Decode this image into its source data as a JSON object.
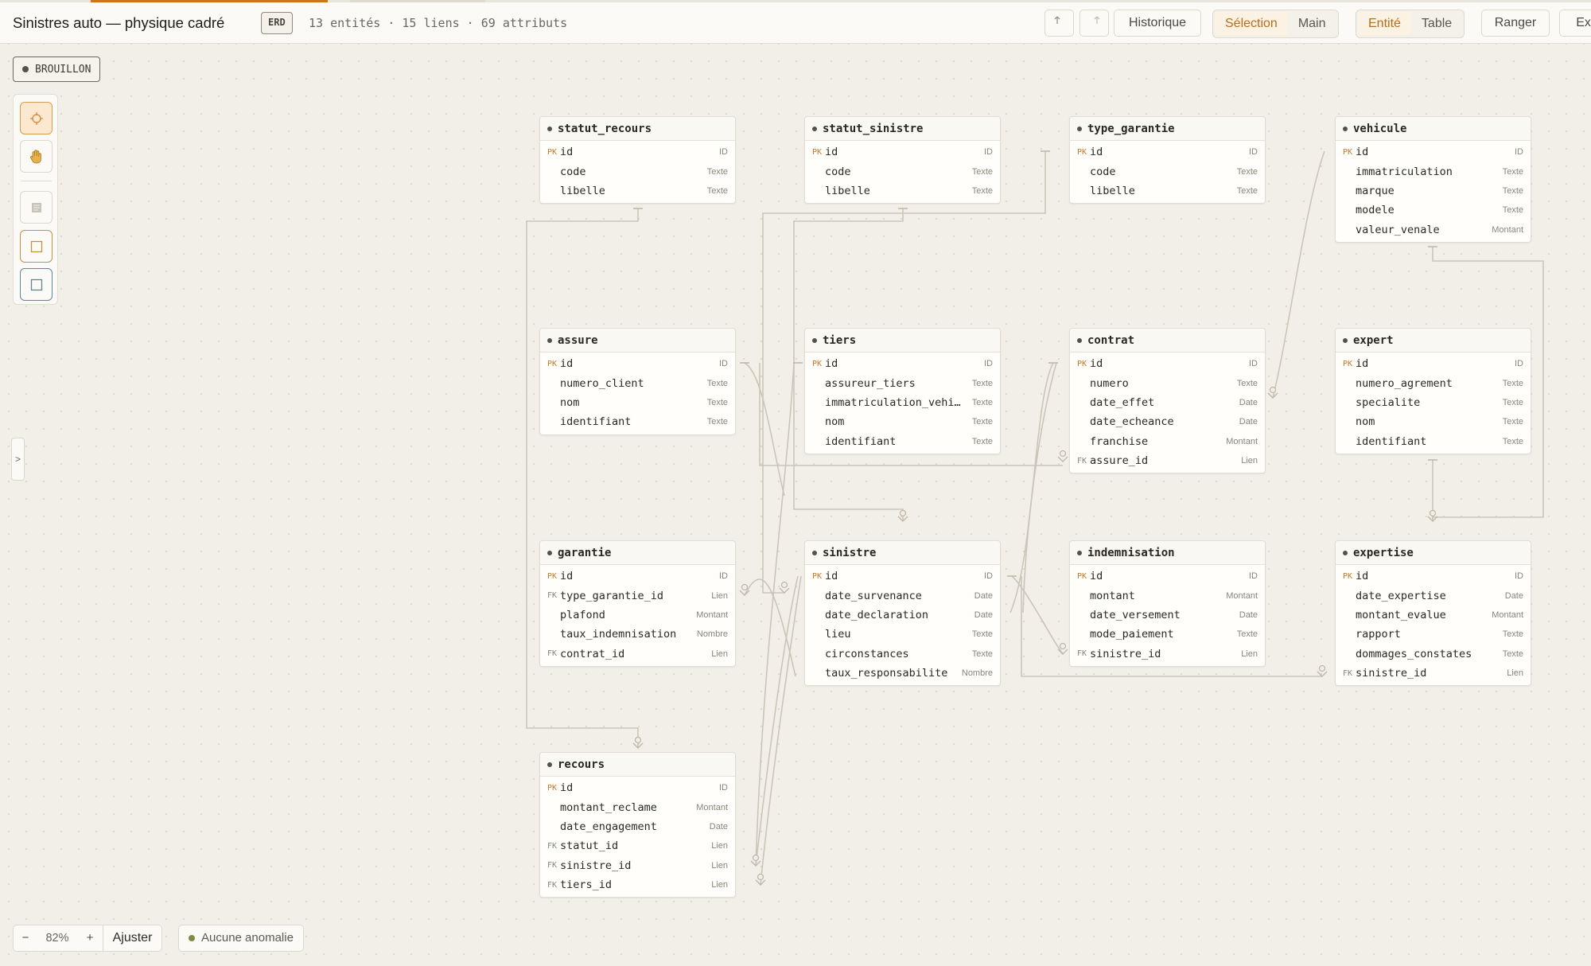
{
  "header": {
    "title": "Sinistres auto — physique cadré",
    "badge": "ERD",
    "stats": "13 entités · 15 liens · 69 attributs",
    "undo_icon": "undo-icon",
    "redo_icon": "redo-icon",
    "history_label": "Historique",
    "mode_selection": "Sélection",
    "mode_hand": "Main",
    "view_entity": "Entité",
    "view_table": "Table",
    "arrange_label": "Ranger",
    "export_label": "Exp"
  },
  "status_badge": "BROUILLON",
  "sidebar_toggle": ">",
  "zoom": {
    "minus": "−",
    "value": "82%",
    "plus": "+",
    "fit_label": "Ajuster"
  },
  "anomalies": "Aucune anomalie",
  "tools": [
    "crosshair-icon",
    "hand-icon",
    "note-icon",
    "entity-box-icon",
    "table-box-icon"
  ],
  "entities": [
    {
      "name": "statut_recours",
      "fields": [
        {
          "key": "PK",
          "name": "id",
          "type": "ID"
        },
        {
          "key": "",
          "name": "code",
          "type": "Texte"
        },
        {
          "key": "",
          "name": "libelle",
          "type": "Texte"
        }
      ]
    },
    {
      "name": "statut_sinistre",
      "fields": [
        {
          "key": "PK",
          "name": "id",
          "type": "ID"
        },
        {
          "key": "",
          "name": "code",
          "type": "Texte"
        },
        {
          "key": "",
          "name": "libelle",
          "type": "Texte"
        }
      ]
    },
    {
      "name": "type_garantie",
      "fields": [
        {
          "key": "PK",
          "name": "id",
          "type": "ID"
        },
        {
          "key": "",
          "name": "code",
          "type": "Texte"
        },
        {
          "key": "",
          "name": "libelle",
          "type": "Texte"
        }
      ]
    },
    {
      "name": "vehicule",
      "fields": [
        {
          "key": "PK",
          "name": "id",
          "type": "ID"
        },
        {
          "key": "",
          "name": "immatriculation",
          "type": "Texte"
        },
        {
          "key": "",
          "name": "marque",
          "type": "Texte"
        },
        {
          "key": "",
          "name": "modele",
          "type": "Texte"
        },
        {
          "key": "",
          "name": "valeur_venale",
          "type": "Montant"
        }
      ]
    },
    {
      "name": "assure",
      "fields": [
        {
          "key": "PK",
          "name": "id",
          "type": "ID"
        },
        {
          "key": "",
          "name": "numero_client",
          "type": "Texte"
        },
        {
          "key": "",
          "name": "nom",
          "type": "Texte"
        },
        {
          "key": "",
          "name": "identifiant",
          "type": "Texte"
        }
      ]
    },
    {
      "name": "tiers",
      "fields": [
        {
          "key": "PK",
          "name": "id",
          "type": "ID"
        },
        {
          "key": "",
          "name": "assureur_tiers",
          "type": "Texte"
        },
        {
          "key": "",
          "name": "immatriculation_vehi…",
          "type": "Texte"
        },
        {
          "key": "",
          "name": "nom",
          "type": "Texte"
        },
        {
          "key": "",
          "name": "identifiant",
          "type": "Texte"
        }
      ]
    },
    {
      "name": "contrat",
      "fields": [
        {
          "key": "PK",
          "name": "id",
          "type": "ID"
        },
        {
          "key": "",
          "name": "numero",
          "type": "Texte"
        },
        {
          "key": "",
          "name": "date_effet",
          "type": "Date"
        },
        {
          "key": "",
          "name": "date_echeance",
          "type": "Date"
        },
        {
          "key": "",
          "name": "franchise",
          "type": "Montant"
        },
        {
          "key": "FK",
          "name": "assure_id",
          "type": "Lien"
        }
      ]
    },
    {
      "name": "expert",
      "fields": [
        {
          "key": "PK",
          "name": "id",
          "type": "ID"
        },
        {
          "key": "",
          "name": "numero_agrement",
          "type": "Texte"
        },
        {
          "key": "",
          "name": "specialite",
          "type": "Texte"
        },
        {
          "key": "",
          "name": "nom",
          "type": "Texte"
        },
        {
          "key": "",
          "name": "identifiant",
          "type": "Texte"
        }
      ]
    },
    {
      "name": "garantie",
      "fields": [
        {
          "key": "PK",
          "name": "id",
          "type": "ID"
        },
        {
          "key": "FK",
          "name": "type_garantie_id",
          "type": "Lien"
        },
        {
          "key": "",
          "name": "plafond",
          "type": "Montant"
        },
        {
          "key": "",
          "name": "taux_indemnisation",
          "type": "Nombre"
        },
        {
          "key": "FK",
          "name": "contrat_id",
          "type": "Lien"
        }
      ]
    },
    {
      "name": "sinistre",
      "fields": [
        {
          "key": "PK",
          "name": "id",
          "type": "ID"
        },
        {
          "key": "",
          "name": "date_survenance",
          "type": "Date"
        },
        {
          "key": "",
          "name": "date_declaration",
          "type": "Date"
        },
        {
          "key": "",
          "name": "lieu",
          "type": "Texte"
        },
        {
          "key": "",
          "name": "circonstances",
          "type": "Texte"
        },
        {
          "key": "",
          "name": "taux_responsabilite",
          "type": "Nombre"
        }
      ]
    },
    {
      "name": "indemnisation",
      "fields": [
        {
          "key": "PK",
          "name": "id",
          "type": "ID"
        },
        {
          "key": "",
          "name": "montant",
          "type": "Montant"
        },
        {
          "key": "",
          "name": "date_versement",
          "type": "Date"
        },
        {
          "key": "",
          "name": "mode_paiement",
          "type": "Texte"
        },
        {
          "key": "FK",
          "name": "sinistre_id",
          "type": "Lien"
        }
      ]
    },
    {
      "name": "expertise",
      "fields": [
        {
          "key": "PK",
          "name": "id",
          "type": "ID"
        },
        {
          "key": "",
          "name": "date_expertise",
          "type": "Date"
        },
        {
          "key": "",
          "name": "montant_evalue",
          "type": "Montant"
        },
        {
          "key": "",
          "name": "rapport",
          "type": "Texte"
        },
        {
          "key": "",
          "name": "dommages_constates",
          "type": "Texte"
        },
        {
          "key": "FK",
          "name": "sinistre_id",
          "type": "Lien"
        }
      ]
    },
    {
      "name": "recours",
      "fields": [
        {
          "key": "PK",
          "name": "id",
          "type": "ID"
        },
        {
          "key": "",
          "name": "montant_reclame",
          "type": "Montant"
        },
        {
          "key": "",
          "name": "date_engagement",
          "type": "Date"
        },
        {
          "key": "FK",
          "name": "statut_id",
          "type": "Lien"
        },
        {
          "key": "FK",
          "name": "sinistre_id",
          "type": "Lien"
        },
        {
          "key": "FK",
          "name": "tiers_id",
          "type": "Lien"
        }
      ]
    }
  ]
}
